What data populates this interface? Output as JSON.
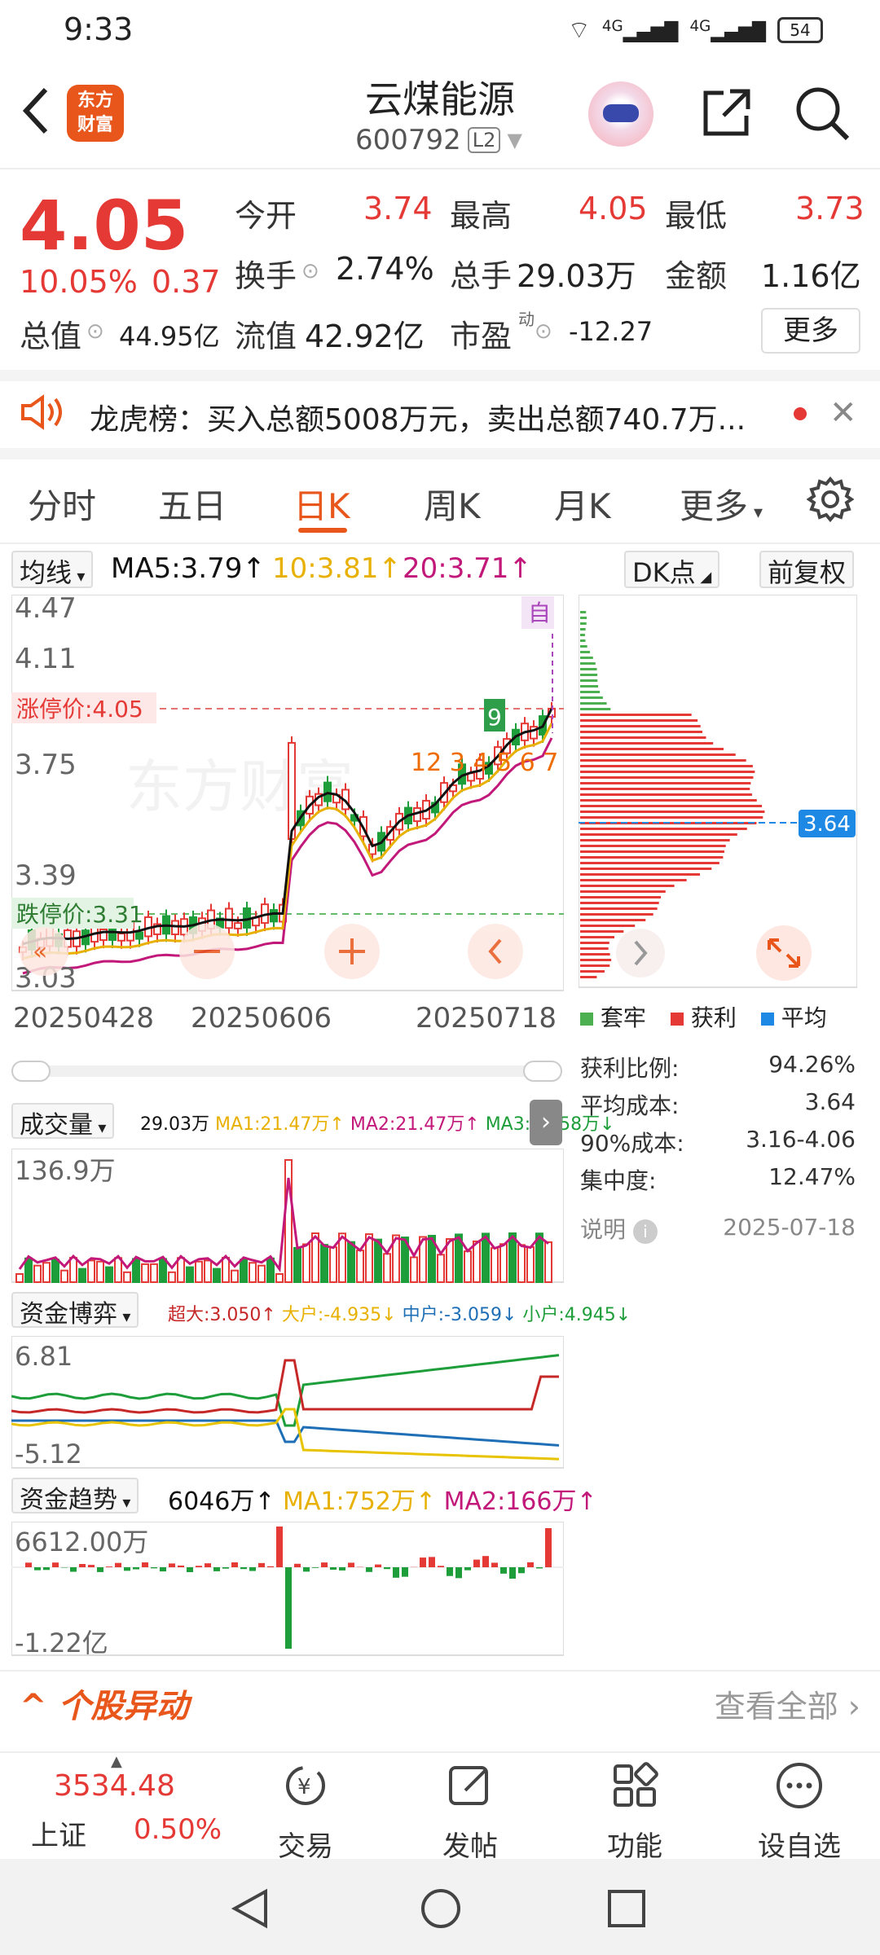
{
  "status": {
    "time": "9:33",
    "battery": "54",
    "net1": "4G",
    "net2": "4G"
  },
  "header": {
    "logo_line1": "东方",
    "logo_line2": "财富",
    "name": "云煤能源",
    "code": "600792",
    "level": "L2"
  },
  "quote": {
    "price": "4.05",
    "change_pct": "10.05%",
    "change": "0.37",
    "open_label": "今开",
    "open": "3.74",
    "high_label": "最高",
    "high": "4.05",
    "low_label": "最低",
    "low": "3.73",
    "turnover_label": "换手",
    "turnover": "2.74%",
    "volume_label": "总手",
    "volume": "29.03万",
    "amount_label": "金额",
    "amount": "1.16亿",
    "mcap_label": "总值",
    "mcap": "44.95亿",
    "float_label": "流值",
    "float": "42.92亿",
    "pe_label": "市盈",
    "pe_sup": "动",
    "pe": "-12.27",
    "more": "更多"
  },
  "dragon": {
    "text": "龙虎榜：买入总额5008万元，卖出总额740.7万..."
  },
  "tabs": [
    {
      "label": "分时"
    },
    {
      "label": "五日"
    },
    {
      "label": "日K"
    },
    {
      "label": "周K"
    },
    {
      "label": "月K"
    },
    {
      "label": "更多"
    }
  ],
  "kline": {
    "ma_select": "均线",
    "ma5": "MA5:3.79↑",
    "ma10": "10:3.81↑",
    "ma20": "20:3.71↑",
    "dk": "DK点",
    "fq": "前复权",
    "y_ticks": [
      "4.47",
      "4.11",
      "3.75",
      "3.39",
      "3.03"
    ],
    "limit_up": "涨停价:4.05",
    "limit_down": "跌停价:3.31",
    "dates": [
      "20250428",
      "20250606",
      "20250718"
    ],
    "auto": "自",
    "nine": "9",
    "seq_labels": "12 3 4 5 6 7 8"
  },
  "profile": {
    "avg_tag": "3.64",
    "legend": [
      {
        "label": "套牢",
        "color": "#4caf50"
      },
      {
        "label": "获利",
        "color": "#e53935"
      },
      {
        "label": "平均",
        "color": "#1e88e5"
      }
    ],
    "rows": [
      {
        "label": "获利比例:",
        "value": "94.26%"
      },
      {
        "label": "平均成本:",
        "value": "3.64"
      },
      {
        "label": "90%成本:",
        "value": "3.16-4.06"
      },
      {
        "label": "集中度:",
        "value": "12.47%"
      }
    ],
    "note": "说明",
    "date": "2025-07-18"
  },
  "volume": {
    "title": "成交量",
    "current": "29.03万",
    "ma1": "MA1:21.47万↑",
    "ma2": "MA2:21.47万↑",
    "ma3": "MA3:33.58万↓",
    "max": "136.9万"
  },
  "fund_game": {
    "title": "资金博弈",
    "super": "超大:3.050↑",
    "big": "大户:-4.935↓",
    "mid": "中户:-3.059↓",
    "small": "小户:4.945↓",
    "max": "6.81",
    "min": "-5.12"
  },
  "fund_trend": {
    "title": "资金趋势",
    "current": "6046万↑",
    "ma1": "MA1:752万↑",
    "ma2": "MA2:166万↑",
    "max": "6612.00万",
    "min": "-1.22亿"
  },
  "anomaly": {
    "title": "个股异动",
    "view_all": "查看全部"
  },
  "bottom": {
    "index_value": "3534.48",
    "index_name": "上证",
    "index_pct": "0.50%",
    "trade": "交易",
    "post": "发帖",
    "func": "功能",
    "watch": "设自选"
  },
  "colors": {
    "accent": "#e8561c",
    "up": "#e53935",
    "down": "#1e9e3a",
    "ma5": "#111111",
    "ma10": "#e8b000",
    "ma20": "#c2187a"
  }
}
